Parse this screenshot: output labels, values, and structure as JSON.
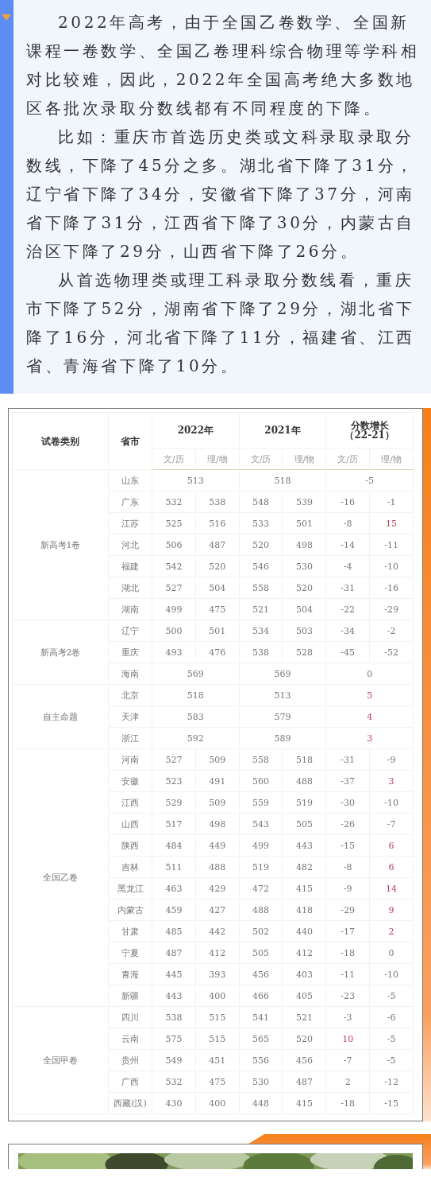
{
  "article": {
    "paragraphs": [
      "2022年高考，由于全国乙卷数学、全国新课程一卷数学、全国乙卷理科综合物理等学科相对比较难，因此，2022年全国高考绝大多数地区各批次录取分数线都有不同程度的下降。",
      "比如：重庆市首选历史类或文科录取录取分数线，下降了45分之多。湖北省下降了31分，辽宁省下降了34分，安徽省下降了37分，河南省下降了31分，江西省下降了30分，内蒙古自治区下降了29分，山西省下降了26分。",
      "从首选物理类或理工科录取分数线看，重庆市下降了52分，湖南省下降了29分，湖北省下降了16分，河北省下降了11分，福建省、江西省、青海省下降了10分。"
    ]
  },
  "table": {
    "headers": {
      "category": "试卷类别",
      "province": "省市",
      "years": [
        "2022年",
        "2021年"
      ],
      "diff_title": "分数增长",
      "diff_range": "（22-21）",
      "subcols": [
        "文/历",
        "理/物",
        "文/历",
        "理/物",
        "文/历",
        "理/物"
      ]
    },
    "groups": [
      {
        "name": "新高考1卷",
        "rows": [
          {
            "province": "山东",
            "y2022": [
              "513"
            ],
            "y2021": [
              "518"
            ],
            "diff": [
              {
                "text": "-5",
                "positive": false
              }
            ]
          },
          {
            "province": "广东",
            "y2022": [
              "532",
              "538"
            ],
            "y2021": [
              "548",
              "539"
            ],
            "diff": [
              {
                "text": "-16",
                "positive": false
              },
              {
                "text": "-1",
                "positive": false
              }
            ]
          },
          {
            "province": "江苏",
            "y2022": [
              "525",
              "516"
            ],
            "y2021": [
              "533",
              "501"
            ],
            "diff": [
              {
                "text": "-8",
                "positive": false
              },
              {
                "text": "15",
                "positive": true
              }
            ]
          },
          {
            "province": "河北",
            "y2022": [
              "506",
              "487"
            ],
            "y2021": [
              "520",
              "498"
            ],
            "diff": [
              {
                "text": "-14",
                "positive": false
              },
              {
                "text": "-11",
                "positive": false
              }
            ]
          },
          {
            "province": "福建",
            "y2022": [
              "542",
              "520"
            ],
            "y2021": [
              "546",
              "530"
            ],
            "diff": [
              {
                "text": "-4",
                "positive": false
              },
              {
                "text": "-10",
                "positive": false
              }
            ]
          },
          {
            "province": "湖北",
            "y2022": [
              "527",
              "504"
            ],
            "y2021": [
              "558",
              "520"
            ],
            "diff": [
              {
                "text": "-31",
                "positive": false
              },
              {
                "text": "-16",
                "positive": false
              }
            ]
          },
          {
            "province": "湖南",
            "y2022": [
              "499",
              "475"
            ],
            "y2021": [
              "521",
              "504"
            ],
            "diff": [
              {
                "text": "-22",
                "positive": false
              },
              {
                "text": "-29",
                "positive": false
              }
            ]
          }
        ]
      },
      {
        "name": "新高考2卷",
        "rows": [
          {
            "province": "辽宁",
            "y2022": [
              "500",
              "501"
            ],
            "y2021": [
              "534",
              "503"
            ],
            "diff": [
              {
                "text": "-34",
                "positive": false
              },
              {
                "text": "-2",
                "positive": false
              }
            ]
          },
          {
            "province": "重庆",
            "y2022": [
              "493",
              "476"
            ],
            "y2021": [
              "538",
              "528"
            ],
            "diff": [
              {
                "text": "-45",
                "positive": false
              },
              {
                "text": "-52",
                "positive": false
              }
            ]
          },
          {
            "province": "海南",
            "y2022": [
              "569"
            ],
            "y2021": [
              "569"
            ],
            "diff": [
              {
                "text": "0",
                "positive": false
              }
            ]
          }
        ]
      },
      {
        "name": "自主命题",
        "rows": [
          {
            "province": "北京",
            "y2022": [
              "518"
            ],
            "y2021": [
              "513"
            ],
            "diff": [
              {
                "text": "5",
                "positive": true
              }
            ]
          },
          {
            "province": "天津",
            "y2022": [
              "583"
            ],
            "y2021": [
              "579"
            ],
            "diff": [
              {
                "text": "4",
                "positive": true
              }
            ]
          },
          {
            "province": "浙江",
            "y2022": [
              "592"
            ],
            "y2021": [
              "589"
            ],
            "diff": [
              {
                "text": "3",
                "positive": true
              }
            ]
          }
        ]
      },
      {
        "name": "全国乙卷",
        "rows": [
          {
            "province": "河南",
            "y2022": [
              "527",
              "509"
            ],
            "y2021": [
              "558",
              "518"
            ],
            "diff": [
              {
                "text": "-31",
                "positive": false
              },
              {
                "text": "-9",
                "positive": false
              }
            ]
          },
          {
            "province": "安徽",
            "y2022": [
              "523",
              "491"
            ],
            "y2021": [
              "560",
              "488"
            ],
            "diff": [
              {
                "text": "-37",
                "positive": false
              },
              {
                "text": "3",
                "positive": true
              }
            ]
          },
          {
            "province": "江西",
            "y2022": [
              "529",
              "509"
            ],
            "y2021": [
              "559",
              "519"
            ],
            "diff": [
              {
                "text": "-30",
                "positive": false
              },
              {
                "text": "-10",
                "positive": false
              }
            ]
          },
          {
            "province": "山西",
            "y2022": [
              "517",
              "498"
            ],
            "y2021": [
              "543",
              "505"
            ],
            "diff": [
              {
                "text": "-26",
                "positive": false
              },
              {
                "text": "-7",
                "positive": false
              }
            ]
          },
          {
            "province": "陕西",
            "y2022": [
              "484",
              "449"
            ],
            "y2021": [
              "499",
              "443"
            ],
            "diff": [
              {
                "text": "-15",
                "positive": false
              },
              {
                "text": "6",
                "positive": true
              }
            ]
          },
          {
            "province": "吉林",
            "y2022": [
              "511",
              "488"
            ],
            "y2021": [
              "519",
              "482"
            ],
            "diff": [
              {
                "text": "-8",
                "positive": false
              },
              {
                "text": "6",
                "positive": true
              }
            ]
          },
          {
            "province": "黑龙江",
            "y2022": [
              "463",
              "429"
            ],
            "y2021": [
              "472",
              "415"
            ],
            "diff": [
              {
                "text": "-9",
                "positive": false
              },
              {
                "text": "14",
                "positive": true
              }
            ]
          },
          {
            "province": "内蒙古",
            "y2022": [
              "459",
              "427"
            ],
            "y2021": [
              "488",
              "418"
            ],
            "diff": [
              {
                "text": "-29",
                "positive": false
              },
              {
                "text": "9",
                "positive": true
              }
            ]
          },
          {
            "province": "甘肃",
            "y2022": [
              "485",
              "442"
            ],
            "y2021": [
              "502",
              "440"
            ],
            "diff": [
              {
                "text": "-17",
                "positive": false
              },
              {
                "text": "2",
                "positive": true
              }
            ]
          },
          {
            "province": "宁夏",
            "y2022": [
              "487",
              "412"
            ],
            "y2021": [
              "505",
              "412"
            ],
            "diff": [
              {
                "text": "-18",
                "positive": false
              },
              {
                "text": "0",
                "positive": false
              }
            ]
          },
          {
            "province": "青海",
            "y2022": [
              "445",
              "393"
            ],
            "y2021": [
              "456",
              "403"
            ],
            "diff": [
              {
                "text": "-11",
                "positive": false
              },
              {
                "text": "-10",
                "positive": false
              }
            ]
          },
          {
            "province": "新疆",
            "y2022": [
              "443",
              "400"
            ],
            "y2021": [
              "466",
              "405"
            ],
            "diff": [
              {
                "text": "-23",
                "positive": false
              },
              {
                "text": "-5",
                "positive": false
              }
            ]
          }
        ]
      },
      {
        "name": "全国甲卷",
        "rows": [
          {
            "province": "四川",
            "y2022": [
              "538",
              "515"
            ],
            "y2021": [
              "541",
              "521"
            ],
            "diff": [
              {
                "text": "-3",
                "positive": false
              },
              {
                "text": "-6",
                "positive": false
              }
            ]
          },
          {
            "province": "云南",
            "y2022": [
              "575",
              "515"
            ],
            "y2021": [
              "565",
              "520"
            ],
            "diff": [
              {
                "text": "10",
                "positive": true
              },
              {
                "text": "-5",
                "positive": false
              }
            ]
          },
          {
            "province": "贵州",
            "y2022": [
              "549",
              "451"
            ],
            "y2021": [
              "556",
              "456"
            ],
            "diff": [
              {
                "text": "-7",
                "positive": false
              },
              {
                "text": "-5",
                "positive": false
              }
            ]
          },
          {
            "province": "广西",
            "y2022": [
              "532",
              "475"
            ],
            "y2021": [
              "530",
              "487"
            ],
            "diff": [
              {
                "text": "2",
                "positive": false
              },
              {
                "text": "-12",
                "positive": false
              }
            ]
          },
          {
            "province": "西藏(汉)",
            "y2022": [
              "430",
              "400"
            ],
            "y2021": [
              "448",
              "415"
            ],
            "diff": [
              {
                "text": "-18",
                "positive": false
              },
              {
                "text": "-15",
                "positive": false
              }
            ]
          }
        ]
      }
    ]
  }
}
